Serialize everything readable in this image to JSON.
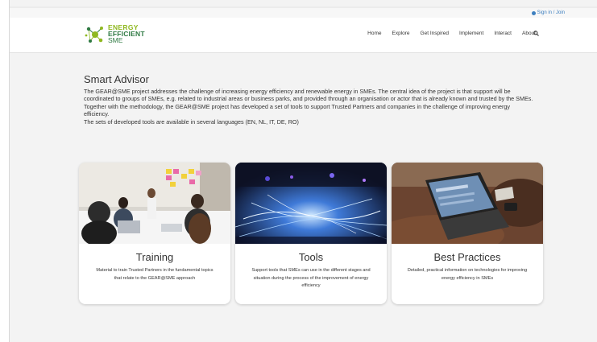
{
  "topbar": {
    "signin_label": "Sign in / Join"
  },
  "logo": {
    "line1": "ENERGY",
    "line2": "EFFICIENT",
    "line3": "SME"
  },
  "nav": {
    "items": [
      "Home",
      "Explore",
      "Get Inspired",
      "Implement",
      "Interact",
      "About"
    ]
  },
  "page": {
    "title": "Smart Advisor",
    "paragraphs": [
      "The GEAR@SME project addresses the challenge of increasing energy efficiency and renewable energy in SMEs. The central idea of the project is that support will be coordinated to groups of SMEs, e.g. related to industrial areas or business parks, and provided through an organisation or actor that is already known and trusted by the SMEs.",
      "Together with the methodology, the GEAR@SME project has developed a set of tools to support Trusted Partners and companies in the challenge of improving energy efficiency.",
      "The sets of developed tools are available in several languages (EN, NL, IT, DE, RO)"
    ]
  },
  "cards": [
    {
      "title": "Training",
      "description": "Material to train Trusted Partners in the fundamental topics that relate to the GEAR@SME approach"
    },
    {
      "title": "Tools",
      "description": "Support tools that SMEs can use in the different stages and situation during the process of the improvement of energy efficiency"
    },
    {
      "title": "Best Practices",
      "description": "Detailed, practical information on technologies for improving energy efficiency in SMEs"
    }
  ],
  "colors": {
    "accent_link": "#3d7fbf",
    "logo_light_green": "#8fb820",
    "logo_dark_green": "#2f7a43"
  }
}
